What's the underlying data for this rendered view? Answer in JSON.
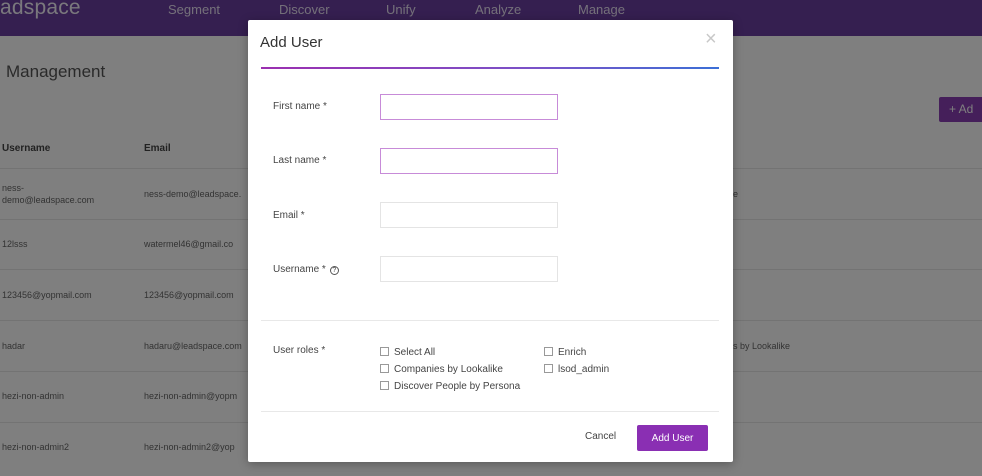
{
  "app": {
    "logo": "adspace",
    "nav": [
      "Segment",
      "Discover",
      "Unify",
      "Analyze",
      "Manage"
    ],
    "page_title": "Management",
    "add_button": "+ Ad",
    "table": {
      "headers": [
        "Username",
        "Email"
      ],
      "rows": [
        {
          "username": "ness-\ndemo@leadspace.com",
          "email": "ness-demo@leadspace.",
          "extra": "e"
        },
        {
          "username": "12lsss",
          "email": "watermel46@gmail.co",
          "extra": ""
        },
        {
          "username": "123456@yopmail.com",
          "email": "123456@yopmail.com",
          "extra": ""
        },
        {
          "username": "hadar",
          "email": "hadaru@leadspace.com",
          "extra": "s by Lookalike"
        },
        {
          "username": "hezi-non-admin",
          "email": "hezi-non-admin@yopm",
          "extra": ""
        },
        {
          "username": "hezi-non-admin2",
          "email": "hezi-non-admin2@yop",
          "extra": ""
        }
      ]
    }
  },
  "modal": {
    "title": "Add User",
    "close_glyph": "×",
    "fields": {
      "first_name": {
        "label": "First name *",
        "value": "",
        "placeholder": ""
      },
      "last_name": {
        "label": "Last name *",
        "value": "",
        "placeholder": ""
      },
      "email": {
        "label": "Email *",
        "value": "",
        "placeholder": ""
      },
      "username": {
        "label": "Username *",
        "value": "",
        "placeholder": "",
        "help_glyph": "?"
      }
    },
    "roles_label": "User roles *",
    "roles": {
      "select_all": "Select All",
      "enrich": "Enrich",
      "companies_by_lookalike": "Companies by Lookalike",
      "lsod_admin": "lsod_admin",
      "discover_people_by_persona": "Discover People by Persona"
    },
    "cancel_label": "Cancel",
    "submit_label": "Add User"
  },
  "colors": {
    "topbar": "#6b3fa0",
    "accent": "#8a2fb3",
    "overlay": "rgba(0,0,0,0.5)"
  }
}
